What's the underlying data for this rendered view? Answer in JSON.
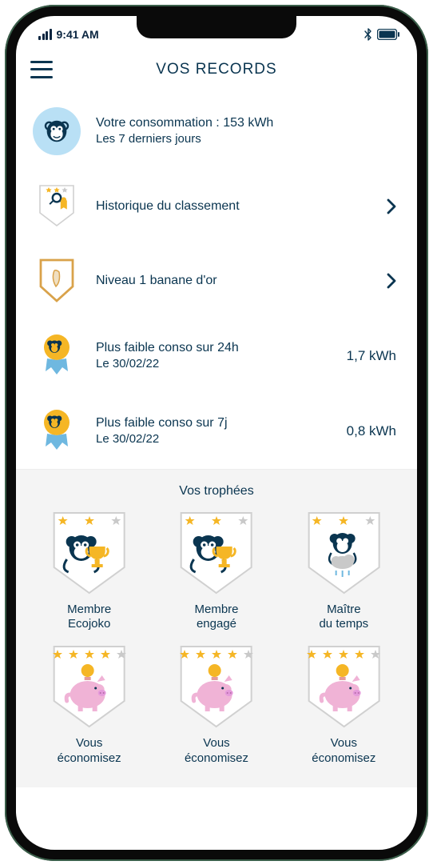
{
  "status": {
    "time": "9:41 AM"
  },
  "header": {
    "title": "VOS RECORDS"
  },
  "consumption": {
    "line1": "Votre consommation : 153 kWh",
    "line2": "Les 7 derniers jours"
  },
  "rows": {
    "history": {
      "label": "Historique du classement"
    },
    "level": {
      "label": "Niveau 1 banane d'or"
    },
    "record24h": {
      "line1": "Plus faible conso sur 24h",
      "line2": "Le 30/02/22",
      "value": "1,7 kWh"
    },
    "record7d": {
      "line1": "Plus faible conso sur 7j",
      "line2": "Le 30/02/22",
      "value": "0,8 kWh"
    }
  },
  "trophies": {
    "title": "Vos trophées",
    "items": [
      {
        "name": "Membre\nEcojoko",
        "stars": 2,
        "max": 3,
        "type": "cup"
      },
      {
        "name": "Membre\nengagé",
        "stars": 2,
        "max": 3,
        "type": "cup"
      },
      {
        "name": "Maître\ndu temps",
        "stars": 2,
        "max": 3,
        "type": "cloud"
      },
      {
        "name": "Vous\néconomisez",
        "stars": 4,
        "max": 5,
        "type": "piggy"
      },
      {
        "name": "Vous\néconomisez",
        "stars": 4,
        "max": 5,
        "type": "piggy"
      },
      {
        "name": "Vous\néconomisez",
        "stars": 4,
        "max": 5,
        "type": "piggy"
      }
    ]
  }
}
